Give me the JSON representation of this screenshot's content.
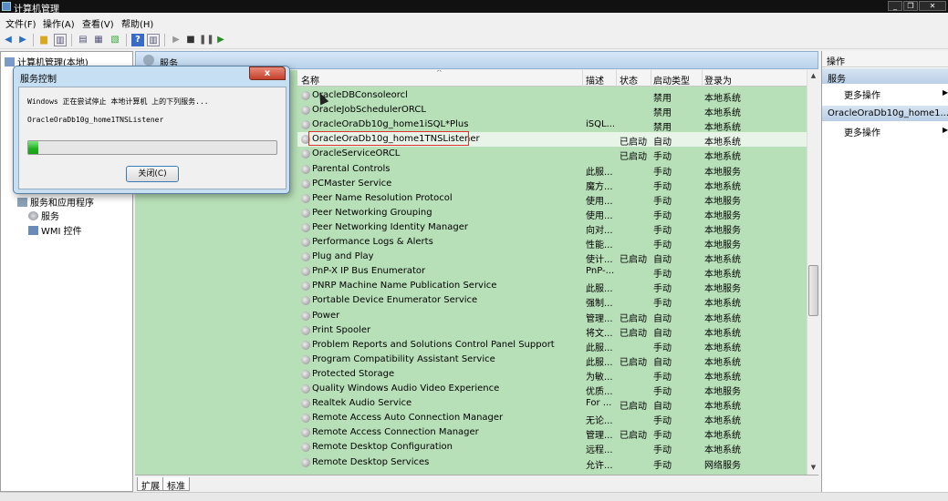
{
  "window": {
    "title": "计算机管理"
  },
  "menu": [
    "文件(F)",
    "操作(A)",
    "查看(V)",
    "帮助(H)"
  ],
  "tree": {
    "root": "计算机管理(本地)",
    "services_apps": "服务和应用程序",
    "services": "服务",
    "wmi": "WMI 控件"
  },
  "panel": {
    "title": "服务"
  },
  "columns": {
    "name": "名称",
    "desc": "描述",
    "status": "状态",
    "startup": "启动类型",
    "logon": "登录为"
  },
  "services": [
    {
      "name": "OracleDBConsoleorcl",
      "desc": "",
      "status": "",
      "startup": "禁用",
      "logon": "本地系统"
    },
    {
      "name": "OracleJobSchedulerORCL",
      "desc": "",
      "status": "",
      "startup": "禁用",
      "logon": "本地系统"
    },
    {
      "name": "OracleOraDb10g_home1iSQL*Plus",
      "desc": "iSQL...",
      "status": "",
      "startup": "禁用",
      "logon": "本地系统"
    },
    {
      "name": "OracleOraDb10g_home1TNSListener",
      "desc": "",
      "status": "已启动",
      "startup": "自动",
      "logon": "本地系统"
    },
    {
      "name": "OracleServiceORCL",
      "desc": "",
      "status": "已启动",
      "startup": "手动",
      "logon": "本地系统"
    },
    {
      "name": "Parental Controls",
      "desc": "此服...",
      "status": "",
      "startup": "手动",
      "logon": "本地服务"
    },
    {
      "name": "PCMaster Service",
      "desc": "魔方...",
      "status": "",
      "startup": "手动",
      "logon": "本地系统"
    },
    {
      "name": "Peer Name Resolution Protocol",
      "desc": "使用...",
      "status": "",
      "startup": "手动",
      "logon": "本地服务"
    },
    {
      "name": "Peer Networking Grouping",
      "desc": "使用...",
      "status": "",
      "startup": "手动",
      "logon": "本地服务"
    },
    {
      "name": "Peer Networking Identity Manager",
      "desc": "向对...",
      "status": "",
      "startup": "手动",
      "logon": "本地服务"
    },
    {
      "name": "Performance Logs & Alerts",
      "desc": "性能...",
      "status": "",
      "startup": "手动",
      "logon": "本地服务"
    },
    {
      "name": "Plug and Play",
      "desc": "使计...",
      "status": "已启动",
      "startup": "自动",
      "logon": "本地系统"
    },
    {
      "name": "PnP-X IP Bus Enumerator",
      "desc": "PnP-...",
      "status": "",
      "startup": "手动",
      "logon": "本地系统"
    },
    {
      "name": "PNRP Machine Name Publication Service",
      "desc": "此服...",
      "status": "",
      "startup": "手动",
      "logon": "本地服务"
    },
    {
      "name": "Portable Device Enumerator Service",
      "desc": "强制...",
      "status": "",
      "startup": "手动",
      "logon": "本地系统"
    },
    {
      "name": "Power",
      "desc": "管理...",
      "status": "已启动",
      "startup": "自动",
      "logon": "本地系统"
    },
    {
      "name": "Print Spooler",
      "desc": "将文...",
      "status": "已启动",
      "startup": "自动",
      "logon": "本地系统"
    },
    {
      "name": "Problem Reports and Solutions Control Panel Support",
      "desc": "此服...",
      "status": "",
      "startup": "手动",
      "logon": "本地系统"
    },
    {
      "name": "Program Compatibility Assistant Service",
      "desc": "此服...",
      "status": "已启动",
      "startup": "自动",
      "logon": "本地系统"
    },
    {
      "name": "Protected Storage",
      "desc": "为敏...",
      "status": "",
      "startup": "手动",
      "logon": "本地系统"
    },
    {
      "name": "Quality Windows Audio Video Experience",
      "desc": "优质...",
      "status": "",
      "startup": "手动",
      "logon": "本地服务"
    },
    {
      "name": "Realtek Audio Service",
      "desc": "For ...",
      "status": "已启动",
      "startup": "自动",
      "logon": "本地系统"
    },
    {
      "name": "Remote Access Auto Connection Manager",
      "desc": "无论...",
      "status": "",
      "startup": "手动",
      "logon": "本地系统"
    },
    {
      "name": "Remote Access Connection Manager",
      "desc": "管理...",
      "status": "已启动",
      "startup": "手动",
      "logon": "本地系统"
    },
    {
      "name": "Remote Desktop Configuration",
      "desc": "远程...",
      "status": "",
      "startup": "手动",
      "logon": "本地系统"
    },
    {
      "name": "Remote Desktop Services",
      "desc": "允许...",
      "status": "",
      "startup": "手动",
      "logon": "网络服务"
    }
  ],
  "tabs": [
    "扩展",
    "标准"
  ],
  "actions": {
    "title": "操作",
    "section1": "服务",
    "more1": "更多操作",
    "section2": "OracleOraDb10g_home1...",
    "more2": "更多操作"
  },
  "dialog": {
    "title": "服务控制",
    "close_x": "x",
    "message": "Windows 正在尝试停止 本地计算机 上的下列服务...",
    "service": "OracleOraDb10g_home1TNSListener",
    "progress": 0.04,
    "button": "关闭(C)"
  }
}
